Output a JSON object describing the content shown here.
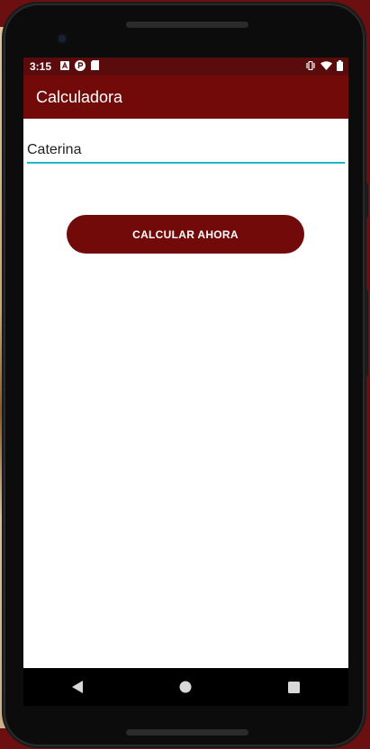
{
  "status_bar": {
    "time": "3:15",
    "icons_left": [
      "keyboard-a-icon",
      "pocket-p-icon",
      "sd-card-icon"
    ],
    "icons_right": [
      "vibrate-icon",
      "wifi-icon",
      "battery-icon"
    ]
  },
  "app_bar": {
    "title": "Calculadora"
  },
  "form": {
    "name_value": "Caterina",
    "button_label": "CALCULAR AHORA"
  },
  "nav_bar": {
    "icons": [
      "back-icon",
      "home-icon",
      "recents-icon"
    ]
  },
  "colors": {
    "primary": "#730a0a",
    "primary_dark": "#5a0b0c",
    "accent": "#1fb6c6",
    "background": "#6b0f10"
  }
}
